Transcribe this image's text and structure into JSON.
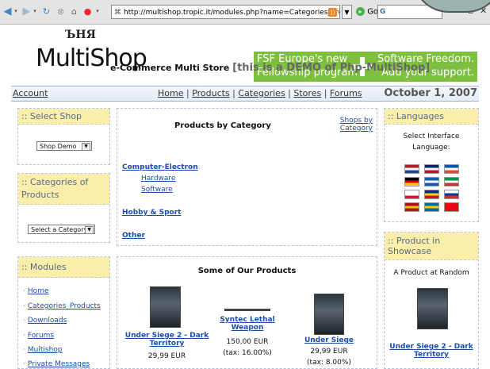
{
  "browser": {
    "url": "http://multishop.tropic.it/modules.php?name=Categories_Products&",
    "go_label": "Go",
    "search_text": "G"
  },
  "header": {
    "logo_mark": "ЪНЯ",
    "logo_text": "MultiShop",
    "tagline": "e-Commerce Multi Store",
    "tagline_demo": "[this is a DEMO of Php-MultiShop]",
    "fsf": {
      "left_line1": "FSF Europe's new",
      "left_line2": "Fellowship program",
      "right_line1": "Software Freedom.",
      "right_line2": "Add your support."
    }
  },
  "nav": {
    "account": "Account",
    "links": [
      "Home",
      "Products",
      "Categories",
      "Stores",
      "Forums"
    ],
    "date": "October 1, 2007"
  },
  "select_shop": {
    "title": ":: Select Shop",
    "selected": "Shop Demo"
  },
  "categories_box": {
    "title": ":: Categories of Products",
    "selected": "Select a Category"
  },
  "modules": {
    "title": ":: Modules",
    "items": [
      "Home",
      "Categories_Products",
      "Downloads",
      "Forums",
      "Multishop",
      "Private Messages"
    ]
  },
  "products_by_category": {
    "title": "Products by Category",
    "shops_link_line1": "Shops by",
    "shops_link_line2": "Category",
    "cat1": "Computer-Electron",
    "cat1_sub1": "Hardware",
    "cat1_sub2": "Software",
    "cat2": "Hobby & Sport",
    "cat3": "Other"
  },
  "some_products": {
    "title": "Some of Our Products",
    "items": [
      {
        "name_line1": "Under Siege 2 - Dark",
        "name_line2": "Territory",
        "price": "29,99 EUR"
      },
      {
        "name_line1": "Syntec Lethal",
        "name_line2": "Weapon",
        "price": "150,00 EUR",
        "tax": "(tax: 16.00%)"
      },
      {
        "name_line1": "Under Siege",
        "price": "29,99 EUR",
        "tax": "(tax: 8.00%)"
      }
    ]
  },
  "languages": {
    "title": ":: Languages",
    "label_line1": "Select Interface",
    "label_line2": "Language:",
    "flags": [
      [
        "#ae1c28",
        "#ffffff",
        "#21468b"
      ],
      [
        "#012169",
        "#ffffff",
        "#c8102e"
      ],
      [
        "#0055a4",
        "#ffffff",
        "#ef4135"
      ],
      [
        "#000000",
        "#dd0000",
        "#ffce00"
      ],
      [
        "#0d5eaf",
        "#ffffff",
        "#0d5eaf"
      ],
      [
        "#009246",
        "#ffffff",
        "#ce2b37"
      ],
      [
        "#ffffff",
        "#ffffff",
        "#dc143c"
      ],
      [
        "#002b7f",
        "#fcd116",
        "#ce1126"
      ],
      [
        "#ffffff",
        "#0039a6",
        "#d52b1e"
      ],
      [
        "#aa151b",
        "#f1bf00",
        "#aa151b"
      ],
      [
        "#006aa7",
        "#fecc00",
        "#006aa7"
      ],
      [
        "#e30a17",
        "#e30a17",
        "#e30a17"
      ]
    ]
  },
  "showcase": {
    "title": ":: Product in Showcase",
    "subtitle": "A Product at Random",
    "name_line1": "Under Siege 2 - Dark",
    "name_line2": "Territory"
  }
}
